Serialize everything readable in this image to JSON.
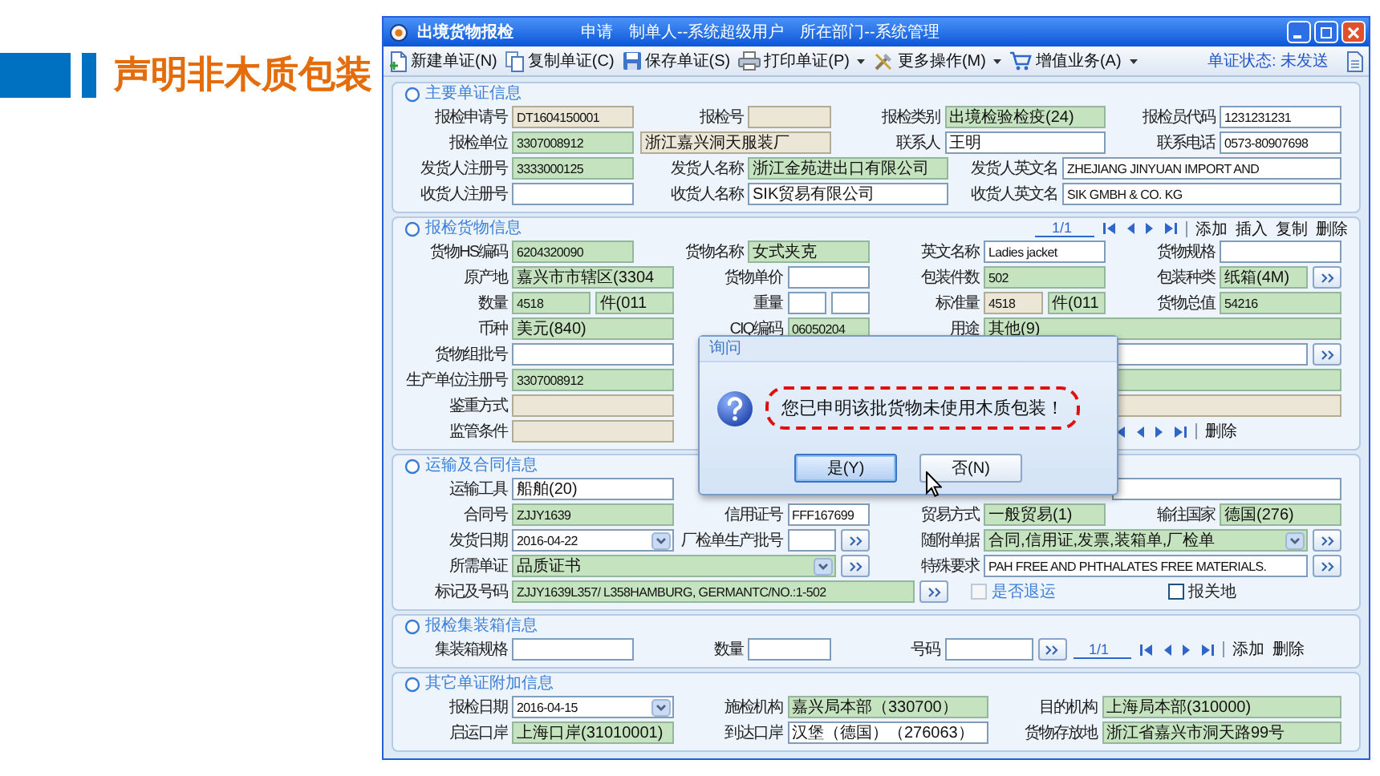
{
  "slide": {
    "title": "声明非木质包装"
  },
  "window": {
    "title": "出境货物报检",
    "info": [
      "申请",
      "制单人--系统超级用户",
      "所在部门--系统管理"
    ]
  },
  "toolbar": {
    "items": [
      {
        "label": "新建单证(N)",
        "menu": false
      },
      {
        "label": "复制单证(C)",
        "menu": false
      },
      {
        "label": "保存单证(S)",
        "menu": false
      },
      {
        "label": "打印单证(P)",
        "menu": true
      },
      {
        "label": "更多操作(M)",
        "menu": true
      },
      {
        "label": "增值业务(A)",
        "menu": true
      }
    ],
    "status": "单证状态: 未发送"
  },
  "sections": [
    {
      "title": "主要单证信息",
      "rows": [
        [
          {
            "kind": "field",
            "label": "报检申请号",
            "fields": [
              {
                "kind": "readonly",
                "value": "DT1604150001"
              }
            ]
          },
          {
            "kind": "field",
            "label": "报检号",
            "fields": [
              {
                "kind": "readonly"
              }
            ]
          },
          {
            "kind": "field",
            "label": "报检类别",
            "fields": [
              {
                "kind": "code",
                "value": "出境检验检疫(24)"
              }
            ]
          },
          {
            "kind": "field",
            "label": "报检员代码",
            "fields": [
              {
                "kind": "input",
                "value": "1231231231"
              }
            ]
          }
        ],
        [
          {
            "kind": "field",
            "label": "报检单位",
            "fields": [
              {
                "kind": "code",
                "value": "3307008912"
              }
            ]
          },
          {
            "kind": "field",
            "fields": [
              {
                "kind": "readonly",
                "value": "浙江嘉兴洞天服装厂"
              }
            ]
          },
          {
            "kind": "field",
            "label": "联系人",
            "fields": [
              {
                "kind": "input",
                "value": "王明"
              }
            ]
          },
          {
            "kind": "field",
            "label": "联系电话",
            "fields": [
              {
                "kind": "input",
                "value": "0573-80907698"
              }
            ]
          }
        ],
        [
          {
            "kind": "field",
            "label": "发货人注册号",
            "fields": [
              {
                "kind": "code",
                "value": "3333000125"
              }
            ]
          },
          {
            "kind": "field",
            "label": "发货人名称",
            "fields": [
              {
                "kind": "code",
                "value": "浙江金苑进出口有限公司"
              }
            ]
          },
          {
            "kind": "field",
            "label": "发货人英文名",
            "fields": [
              {
                "kind": "input",
                "value": "ZHEJIANG JINYUAN IMPORT AND"
              }
            ]
          }
        ],
        [
          {
            "kind": "field",
            "label": "收货人注册号",
            "fields": [
              {
                "kind": "input"
              }
            ]
          },
          {
            "kind": "field",
            "label": "收货人名称",
            "fields": [
              {
                "kind": "input",
                "value": "SIK贸易有限公司"
              }
            ]
          },
          {
            "kind": "field",
            "label": "收货人英文名",
            "fields": [
              {
                "kind": "input",
                "value": "SIK GMBH & CO. KG"
              }
            ]
          }
        ]
      ]
    },
    {
      "title": "报检货物信息",
      "pager": {
        "page": "1/1",
        "actions": [
          "添加",
          "插入",
          "复制",
          "删除"
        ]
      },
      "rows": [
        [
          {
            "kind": "field",
            "label": "货物HS编码",
            "fields": [
              {
                "kind": "code",
                "value": "6204320090"
              }
            ]
          },
          {
            "kind": "field",
            "label": "货物名称",
            "fields": [
              {
                "kind": "code",
                "value": "女式夹克"
              }
            ]
          },
          {
            "kind": "field",
            "label": "英文名称",
            "fields": [
              {
                "kind": "input",
                "value": "Ladies jacket"
              }
            ]
          },
          {
            "kind": "field",
            "label": "货物规格",
            "fields": [
              {
                "kind": "input"
              }
            ]
          }
        ],
        [
          {
            "kind": "field",
            "label": "原产地",
            "fields": [
              {
                "kind": "code",
                "value": "嘉兴市市辖区(3304"
              }
            ]
          },
          {
            "kind": "field",
            "label": "货物单价",
            "fields": [
              {
                "kind": "input"
              }
            ]
          },
          {
            "kind": "field",
            "label": "包装件数",
            "fields": [
              {
                "kind": "code",
                "value": "502"
              }
            ]
          },
          {
            "kind": "field",
            "label": "包装种类",
            "fields": [
              {
                "kind": "code",
                "value": "纸箱(4M)",
                "more": true
              }
            ]
          }
        ],
        [
          {
            "kind": "field",
            "label": "数量",
            "fields": [
              {
                "kind": "code",
                "value": "4518"
              },
              {
                "kind": "code",
                "value": "件(011"
              }
            ]
          },
          {
            "kind": "field",
            "label": "重量",
            "fields": [
              {
                "kind": "input"
              },
              {
                "kind": "input"
              }
            ]
          },
          {
            "kind": "field",
            "label": "标准量",
            "fields": [
              {
                "kind": "readonly",
                "value": "4518"
              },
              {
                "kind": "code",
                "value": "件(011"
              }
            ]
          },
          {
            "kind": "field",
            "label": "货物总值",
            "fields": [
              {
                "kind": "code",
                "value": "54216"
              }
            ]
          }
        ],
        [
          {
            "kind": "field",
            "label": "币种",
            "fields": [
              {
                "kind": "code",
                "value": "美元(840)"
              }
            ]
          },
          {
            "kind": "field",
            "label": "CIQ编码",
            "fields": [
              {
                "kind": "code",
                "value": "06050204"
              }
            ]
          },
          {
            "kind": "field",
            "label": "用途",
            "fields": [
              {
                "kind": "code",
                "value": "其他(9)"
              }
            ]
          }
        ],
        [
          {
            "kind": "field",
            "label": "货物组批号",
            "fields": [
              {
                "kind": "input"
              }
            ]
          },
          "",
          "",
          {
            "kind": "field",
            "fields": [
              {
                "kind": "input",
                "more": true
              }
            ]
          }
        ],
        [
          {
            "kind": "field",
            "label": "生产单位注册号",
            "fields": [
              {
                "kind": "code",
                "value": "3307008912"
              }
            ]
          },
          "",
          "",
          {
            "kind": "field",
            "fields": [
              {
                "kind": "code"
              }
            ]
          }
        ],
        [
          {
            "kind": "field",
            "label": "鉴重方式",
            "fields": [
              {
                "kind": "readonly"
              }
            ]
          },
          "",
          "",
          {
            "kind": "field",
            "fields": [
              {
                "kind": "readonly"
              }
            ]
          }
        ],
        [
          {
            "kind": "field",
            "label": "监管条件",
            "fields": [
              {
                "kind": "readonly"
              }
            ]
          },
          "",
          "",
          {
            "kind": "pager",
            "actions": [
              "删除"
            ]
          }
        ]
      ]
    },
    {
      "title": "运输及合同信息",
      "rows": [
        [
          {
            "kind": "field",
            "label": "运输工具",
            "fields": [
              {
                "kind": "input",
                "value": "船舶(20)"
              }
            ]
          },
          "",
          "",
          {
            "kind": "field",
            "fields": [
              {
                "kind": "input"
              }
            ]
          }
        ],
        [
          {
            "kind": "field",
            "label": "合同号",
            "fields": [
              {
                "kind": "code",
                "value": "ZJJY1639"
              }
            ]
          },
          {
            "kind": "field",
            "label": "信用证号",
            "fields": [
              {
                "kind": "input",
                "value": "FFF167699"
              }
            ]
          },
          {
            "kind": "field",
            "label": "贸易方式",
            "fields": [
              {
                "kind": "code",
                "value": "一般贸易(1)"
              }
            ]
          },
          {
            "kind": "field",
            "label": "输往国家",
            "fields": [
              {
                "kind": "code",
                "value": "德国(276)"
              }
            ]
          }
        ],
        [
          {
            "kind": "field",
            "label": "发货日期",
            "fields": [
              {
                "kind": "input",
                "value": "2016-04-22",
                "dropdown": true
              }
            ]
          },
          {
            "kind": "field",
            "label": "厂检单生产批号",
            "fields": [
              {
                "kind": "input",
                "more": true
              }
            ]
          },
          {
            "kind": "field",
            "label": "随附单据",
            "fields": [
              {
                "kind": "code",
                "value": "合同,信用证,发票,装箱单,厂检单",
                "dropdown": true,
                "more": true
              }
            ]
          }
        ],
        [
          {
            "kind": "field",
            "label": "所需单证",
            "fields": [
              {
                "kind": "code",
                "value": "品质证书",
                "dropdown": true,
                "more": true
              }
            ]
          },
          {
            "kind": "field",
            "label": "特殊要求",
            "fields": [
              {
                "kind": "input",
                "value": "PAH FREE AND PHTHALATES FREE MATERIALS.",
                "more": true
              }
            ]
          }
        ],
        [
          {
            "kind": "field",
            "label": "标记及号码",
            "fields": [
              {
                "kind": "code",
                "value": "ZJJY1639L357/ L358HAMBURG, GERMANTC/NO.:1-502",
                "more": true
              }
            ]
          },
          {
            "kind": "checkbox",
            "label": "是否退运",
            "checked": false,
            "disabled": true
          },
          {
            "kind": "checkbox",
            "label": "报关地",
            "checked": false,
            "disabled": false
          }
        ]
      ]
    },
    {
      "title": "报检集装箱信息",
      "rows": [
        [
          {
            "kind": "field",
            "label": "集装箱规格",
            "fields": [
              {
                "kind": "input"
              }
            ]
          },
          {
            "kind": "field",
            "label": "数量",
            "fields": [
              {
                "kind": "input"
              }
            ]
          },
          {
            "kind": "field",
            "label": "号码",
            "fields": [
              {
                "kind": "input",
                "more": true
              }
            ]
          },
          {
            "kind": "pager",
            "page": "1/1",
            "actions": [
              "添加",
              "删除"
            ]
          }
        ]
      ]
    },
    {
      "title": "其它单证附加信息",
      "rows": [
        [
          {
            "kind": "field",
            "label": "报检日期",
            "fields": [
              {
                "kind": "input",
                "value": "2016-04-15",
                "dropdown": true
              }
            ]
          },
          {
            "kind": "field",
            "label": "施检机构",
            "fields": [
              {
                "kind": "code",
                "value": "嘉兴局本部（330700）"
              }
            ]
          },
          {
            "kind": "field",
            "label": "目的机构",
            "fields": [
              {
                "kind": "code",
                "value": "上海局本部(310000)"
              }
            ]
          }
        ],
        [
          {
            "kind": "field",
            "label": "启运口岸",
            "fields": [
              {
                "kind": "code",
                "value": "上海口岸(31010001)"
              }
            ]
          },
          {
            "kind": "field",
            "label": "到达口岸",
            "fields": [
              {
                "kind": "input",
                "value": "汉堡（德国）（276063）"
              }
            ]
          },
          {
            "kind": "field",
            "label": "货物存放地",
            "fields": [
              {
                "kind": "code",
                "value": "浙江省嘉兴市洞天路99号"
              }
            ]
          }
        ]
      ]
    }
  ],
  "dialog": {
    "title": "询问",
    "message": "您已申明该批货物未使用木质包装！",
    "buttons": [
      {
        "label": "是(Y)",
        "selected": true
      },
      {
        "label": "否(N)",
        "selected": false
      }
    ]
  }
}
